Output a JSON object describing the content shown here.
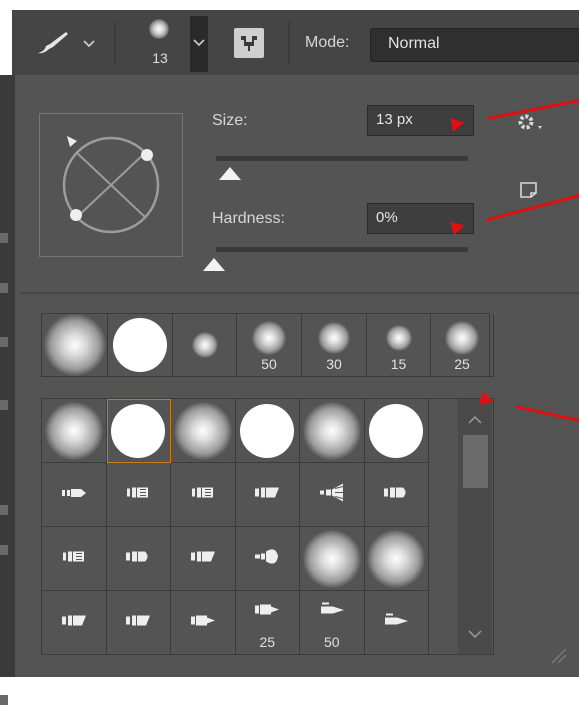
{
  "toolbar": {
    "brush_size_value": "13",
    "mode_label": "Mode:",
    "mode_value": "Normal",
    "icons": [
      "brush-tool-icon",
      "chevron-down-icon",
      "brush-preset-icon",
      "toggle-brush-settings-icon"
    ]
  },
  "brush_options": {
    "size_label": "Size:",
    "size_value": "13 px",
    "size_slider_fraction": 0.03,
    "hardness_label": "Hardness:",
    "hardness_value": "0%",
    "hardness_slider_fraction": 0.0
  },
  "recent_brushes": [
    {
      "kind": "soft",
      "label": ""
    },
    {
      "kind": "hard",
      "label": ""
    },
    {
      "kind": "soft",
      "label": ""
    },
    {
      "kind": "soft",
      "label": "50"
    },
    {
      "kind": "soft",
      "label": "30"
    },
    {
      "kind": "soft",
      "label": "15"
    },
    {
      "kind": "soft",
      "label": "25"
    }
  ],
  "brush_presets": [
    {
      "kind": "soft",
      "label": ""
    },
    {
      "kind": "hard",
      "label": "",
      "selected": true
    },
    {
      "kind": "soft",
      "label": ""
    },
    {
      "kind": "hard",
      "label": ""
    },
    {
      "kind": "soft",
      "label": ""
    },
    {
      "kind": "hard",
      "label": ""
    },
    {
      "kind": "pencil",
      "label": ""
    },
    {
      "kind": "flat",
      "label": ""
    },
    {
      "kind": "flat",
      "label": ""
    },
    {
      "kind": "angle",
      "label": ""
    },
    {
      "kind": "fan",
      "label": ""
    },
    {
      "kind": "round",
      "label": ""
    },
    {
      "kind": "flat",
      "label": ""
    },
    {
      "kind": "round",
      "label": ""
    },
    {
      "kind": "angle",
      "label": ""
    },
    {
      "kind": "blunt",
      "label": ""
    },
    {
      "kind": "soft",
      "label": ""
    },
    {
      "kind": "soft",
      "label": ""
    },
    {
      "kind": "angle",
      "label": ""
    },
    {
      "kind": "angle",
      "label": ""
    },
    {
      "kind": "marker",
      "label": ""
    },
    {
      "kind": "marker",
      "label": "25"
    },
    {
      "kind": "pen",
      "label": "50"
    },
    {
      "kind": "pen",
      "label": ""
    }
  ],
  "accent_colors": {
    "annotation_arrow": "#e01010",
    "selected_outline": "#c87a1e"
  }
}
